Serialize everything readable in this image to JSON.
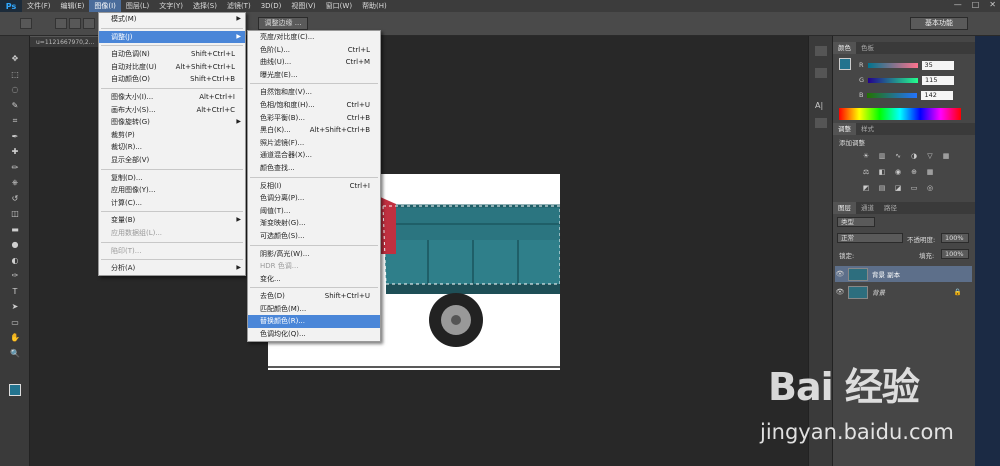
{
  "app": {
    "logo": "Ps"
  },
  "menubar": {
    "items": [
      "文件(F)",
      "编辑(E)",
      "图像(I)",
      "图层(L)",
      "文字(Y)",
      "选择(S)",
      "滤镜(T)",
      "3D(D)",
      "视图(V)",
      "窗口(W)",
      "帮助(H)"
    ],
    "active_index": 2
  },
  "window_controls": {
    "minimize": "—",
    "maximize": "□",
    "close": "✕"
  },
  "options_bar": {
    "button_label": "调整边缘 ...",
    "workspace": "基本功能"
  },
  "document": {
    "tab_label": "u=1121667970,2..."
  },
  "image_menu": {
    "items": [
      {
        "label": "模式(M)",
        "shortcut": "",
        "submenu": true,
        "disabled": false
      },
      {
        "sep": true
      },
      {
        "label": "调整(J)",
        "shortcut": "",
        "submenu": true,
        "disabled": false,
        "highlight": true
      },
      {
        "sep": true
      },
      {
        "label": "自动色调(N)",
        "shortcut": "Shift+Ctrl+L"
      },
      {
        "label": "自动对比度(U)",
        "shortcut": "Alt+Shift+Ctrl+L"
      },
      {
        "label": "自动颜色(O)",
        "shortcut": "Shift+Ctrl+B"
      },
      {
        "sep": true
      },
      {
        "label": "图像大小(I)...",
        "shortcut": "Alt+Ctrl+I"
      },
      {
        "label": "画布大小(S)...",
        "shortcut": "Alt+Ctrl+C"
      },
      {
        "label": "图像旋转(G)",
        "shortcut": "",
        "submenu": true
      },
      {
        "label": "裁剪(P)",
        "shortcut": ""
      },
      {
        "label": "裁切(R)...",
        "shortcut": ""
      },
      {
        "label": "显示全部(V)",
        "shortcut": ""
      },
      {
        "sep": true
      },
      {
        "label": "复制(D)...",
        "shortcut": ""
      },
      {
        "label": "应用图像(Y)...",
        "shortcut": ""
      },
      {
        "label": "计算(C)...",
        "shortcut": ""
      },
      {
        "sep": true
      },
      {
        "label": "变量(B)",
        "shortcut": "",
        "submenu": true
      },
      {
        "label": "应用数据组(L)...",
        "shortcut": "",
        "disabled": true
      },
      {
        "sep": true
      },
      {
        "label": "陷印(T)...",
        "shortcut": "",
        "disabled": true
      },
      {
        "sep": true
      },
      {
        "label": "分析(A)",
        "shortcut": "",
        "submenu": true
      }
    ]
  },
  "adjust_menu": {
    "items": [
      {
        "label": "亮度/对比度(C)...",
        "shortcut": ""
      },
      {
        "label": "色阶(L)...",
        "shortcut": "Ctrl+L"
      },
      {
        "label": "曲线(U)...",
        "shortcut": "Ctrl+M"
      },
      {
        "label": "曝光度(E)...",
        "shortcut": ""
      },
      {
        "sep": true
      },
      {
        "label": "自然饱和度(V)...",
        "shortcut": ""
      },
      {
        "label": "色相/饱和度(H)...",
        "shortcut": "Ctrl+U"
      },
      {
        "label": "色彩平衡(B)...",
        "shortcut": "Ctrl+B"
      },
      {
        "label": "黑白(K)...",
        "shortcut": "Alt+Shift+Ctrl+B"
      },
      {
        "label": "照片滤镜(F)...",
        "shortcut": ""
      },
      {
        "label": "通道混合器(X)...",
        "shortcut": ""
      },
      {
        "label": "颜色查找...",
        "shortcut": ""
      },
      {
        "sep": true
      },
      {
        "label": "反相(I)",
        "shortcut": "Ctrl+I"
      },
      {
        "label": "色调分离(P)...",
        "shortcut": ""
      },
      {
        "label": "阈值(T)...",
        "shortcut": ""
      },
      {
        "label": "渐变映射(G)...",
        "shortcut": ""
      },
      {
        "label": "可选颜色(S)...",
        "shortcut": ""
      },
      {
        "sep": true
      },
      {
        "label": "阴影/高光(W)...",
        "shortcut": ""
      },
      {
        "label": "HDR 色调...",
        "shortcut": "",
        "disabled": true
      },
      {
        "label": "变化...",
        "shortcut": ""
      },
      {
        "sep": true
      },
      {
        "label": "去色(D)",
        "shortcut": "Shift+Ctrl+U"
      },
      {
        "label": "匹配颜色(M)...",
        "shortcut": ""
      },
      {
        "label": "替换颜色(R)...",
        "shortcut": "",
        "highlight": true
      },
      {
        "label": "色调均化(Q)...",
        "shortcut": ""
      }
    ]
  },
  "color_panel": {
    "tabs": [
      "颜色",
      "色板"
    ],
    "r": {
      "label": "R",
      "value": "35"
    },
    "g": {
      "label": "G",
      "value": "115"
    },
    "b": {
      "label": "B",
      "value": "142"
    },
    "fg_color": "#23738e"
  },
  "adjust_panel": {
    "tabs": [
      "调整",
      "样式"
    ],
    "title": "添加调整"
  },
  "layers_panel": {
    "tabs": [
      "图层",
      "通道",
      "路径"
    ],
    "kind": "类型",
    "blend": "正常",
    "opacity_label": "不透明度:",
    "opacity": "100%",
    "lock_label": "锁定:",
    "fill_label": "填充:",
    "fill": "100%",
    "layers": [
      {
        "name": "背景 副本",
        "selected": true
      },
      {
        "name": "背景",
        "selected": false,
        "locked": true
      }
    ]
  },
  "watermark": {
    "logo": "Bai 经验",
    "url": "jingyan.baidu.com"
  }
}
